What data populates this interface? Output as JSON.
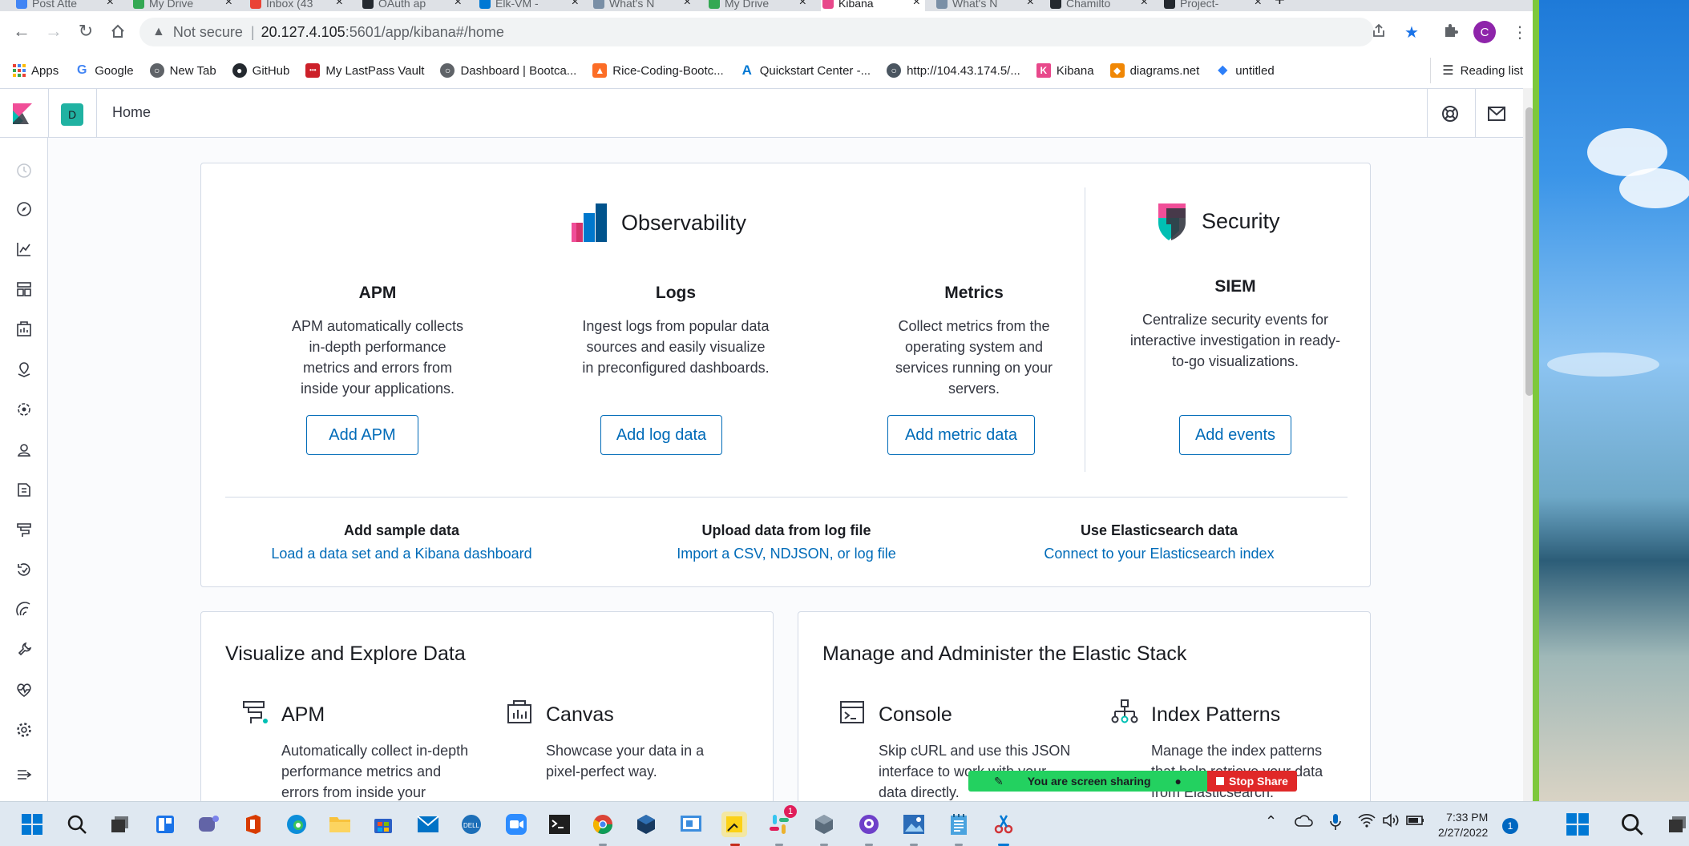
{
  "browser": {
    "tabs": [
      {
        "label": "Post Atte",
        "color": "#4285f4"
      },
      {
        "label": "My Drive",
        "color": "#34a853"
      },
      {
        "label": "Inbox (43",
        "color": "#ea4335"
      },
      {
        "label": "OAuth ap",
        "color": "#24292f"
      },
      {
        "label": "Elk-VM -",
        "color": "#0078d4"
      },
      {
        "label": "What's N",
        "color": "#7a8fa6"
      },
      {
        "label": "My Drive",
        "color": "#34a853"
      },
      {
        "label": "Kibana",
        "color": "#e8488b"
      },
      {
        "label": "What's N",
        "color": "#7a8fa6"
      },
      {
        "label": "Chamilto",
        "color": "#24292f"
      },
      {
        "label": "Project-",
        "color": "#24292f"
      }
    ],
    "new_tab_symbol": "+",
    "address": {
      "security": "Not secure",
      "host": "20.127.4.105",
      "path": ":5601/app/kibana#/home"
    },
    "profile_initial": "C",
    "bookmarks": [
      {
        "label": "Apps",
        "icon": "apps-grid-icon",
        "color": "#ea4335"
      },
      {
        "label": "Google",
        "icon": "google-icon",
        "color": "#4285f4"
      },
      {
        "label": "New Tab",
        "icon": "globe-icon",
        "color": "#5f6368"
      },
      {
        "label": "GitHub",
        "icon": "github-icon",
        "color": "#24292f"
      },
      {
        "label": "My LastPass Vault",
        "icon": "lastpass-icon",
        "color": "#cc2029"
      },
      {
        "label": "Dashboard | Bootca...",
        "icon": "globe-icon",
        "color": "#5f6368"
      },
      {
        "label": "Rice-Coding-Bootc...",
        "icon": "gitlab-icon",
        "color": "#fc6d26"
      },
      {
        "label": "Quickstart Center -...",
        "icon": "azure-icon",
        "color": "#0078d4"
      },
      {
        "label": "http://104.43.174.5/...",
        "icon": "web-icon",
        "color": "#4a5560"
      },
      {
        "label": "Kibana",
        "icon": "kibana-icon",
        "color": "#e8488b"
      },
      {
        "label": "diagrams.net",
        "icon": "diagrams-icon",
        "color": "#f08705"
      },
      {
        "label": "untitled",
        "icon": "diamond-icon",
        "color": "#2d7ff9"
      }
    ],
    "reading_list": "Reading list"
  },
  "kibana": {
    "space_initial": "D",
    "breadcrumb": "Home",
    "solutions": {
      "observability": {
        "title": "Observability"
      },
      "security": {
        "title": "Security"
      },
      "apm": {
        "title": "APM",
        "desc": "APM automatically collects in-depth performance metrics and errors from inside your applications.",
        "button": "Add APM"
      },
      "logs": {
        "title": "Logs",
        "desc": "Ingest logs from popular data sources and easily visualize in preconfigured dashboards.",
        "button": "Add log data"
      },
      "metrics": {
        "title": "Metrics",
        "desc": "Collect metrics from the operating system and services running on your servers.",
        "button": "Add metric data"
      },
      "siem": {
        "title": "SIEM",
        "desc": "Centralize security events for interactive investigation in ready-to-go visualizations.",
        "button": "Add events"
      }
    },
    "data_links": [
      {
        "title": "Add sample data",
        "link": "Load a data set and a Kibana dashboard"
      },
      {
        "title": "Upload data from log file",
        "link": "Import a CSV, NDJSON, or log file"
      },
      {
        "title": "Use Elasticsearch data",
        "link": "Connect to your Elasticsearch index"
      }
    ],
    "visualize": {
      "title": "Visualize and Explore Data",
      "features": [
        {
          "name": "APM",
          "desc": "Automatically collect in-depth performance metrics and errors from inside your applications."
        },
        {
          "name": "Canvas",
          "desc": "Showcase your data in a pixel-perfect way."
        }
      ]
    },
    "manage": {
      "title": "Manage and Administer the Elastic Stack",
      "features": [
        {
          "name": "Console",
          "desc": "Skip cURL and use this JSON interface to work with your data directly."
        },
        {
          "name": "Index Patterns",
          "desc": "Manage the index patterns that help retrieve your data from Elasticsearch."
        }
      ]
    }
  },
  "screen_share": {
    "message": "You are screen sharing",
    "stop_label": "Stop Share"
  },
  "taskbar": {
    "time": "7:33 PM",
    "date": "2/27/2022",
    "notification_count": "1",
    "slack_badge": "1"
  },
  "colors": {
    "kibana_link": "#006bb8",
    "kibana_text": "#343741",
    "screen_share_green": "#23d160",
    "stop_share_red": "#e02828"
  }
}
